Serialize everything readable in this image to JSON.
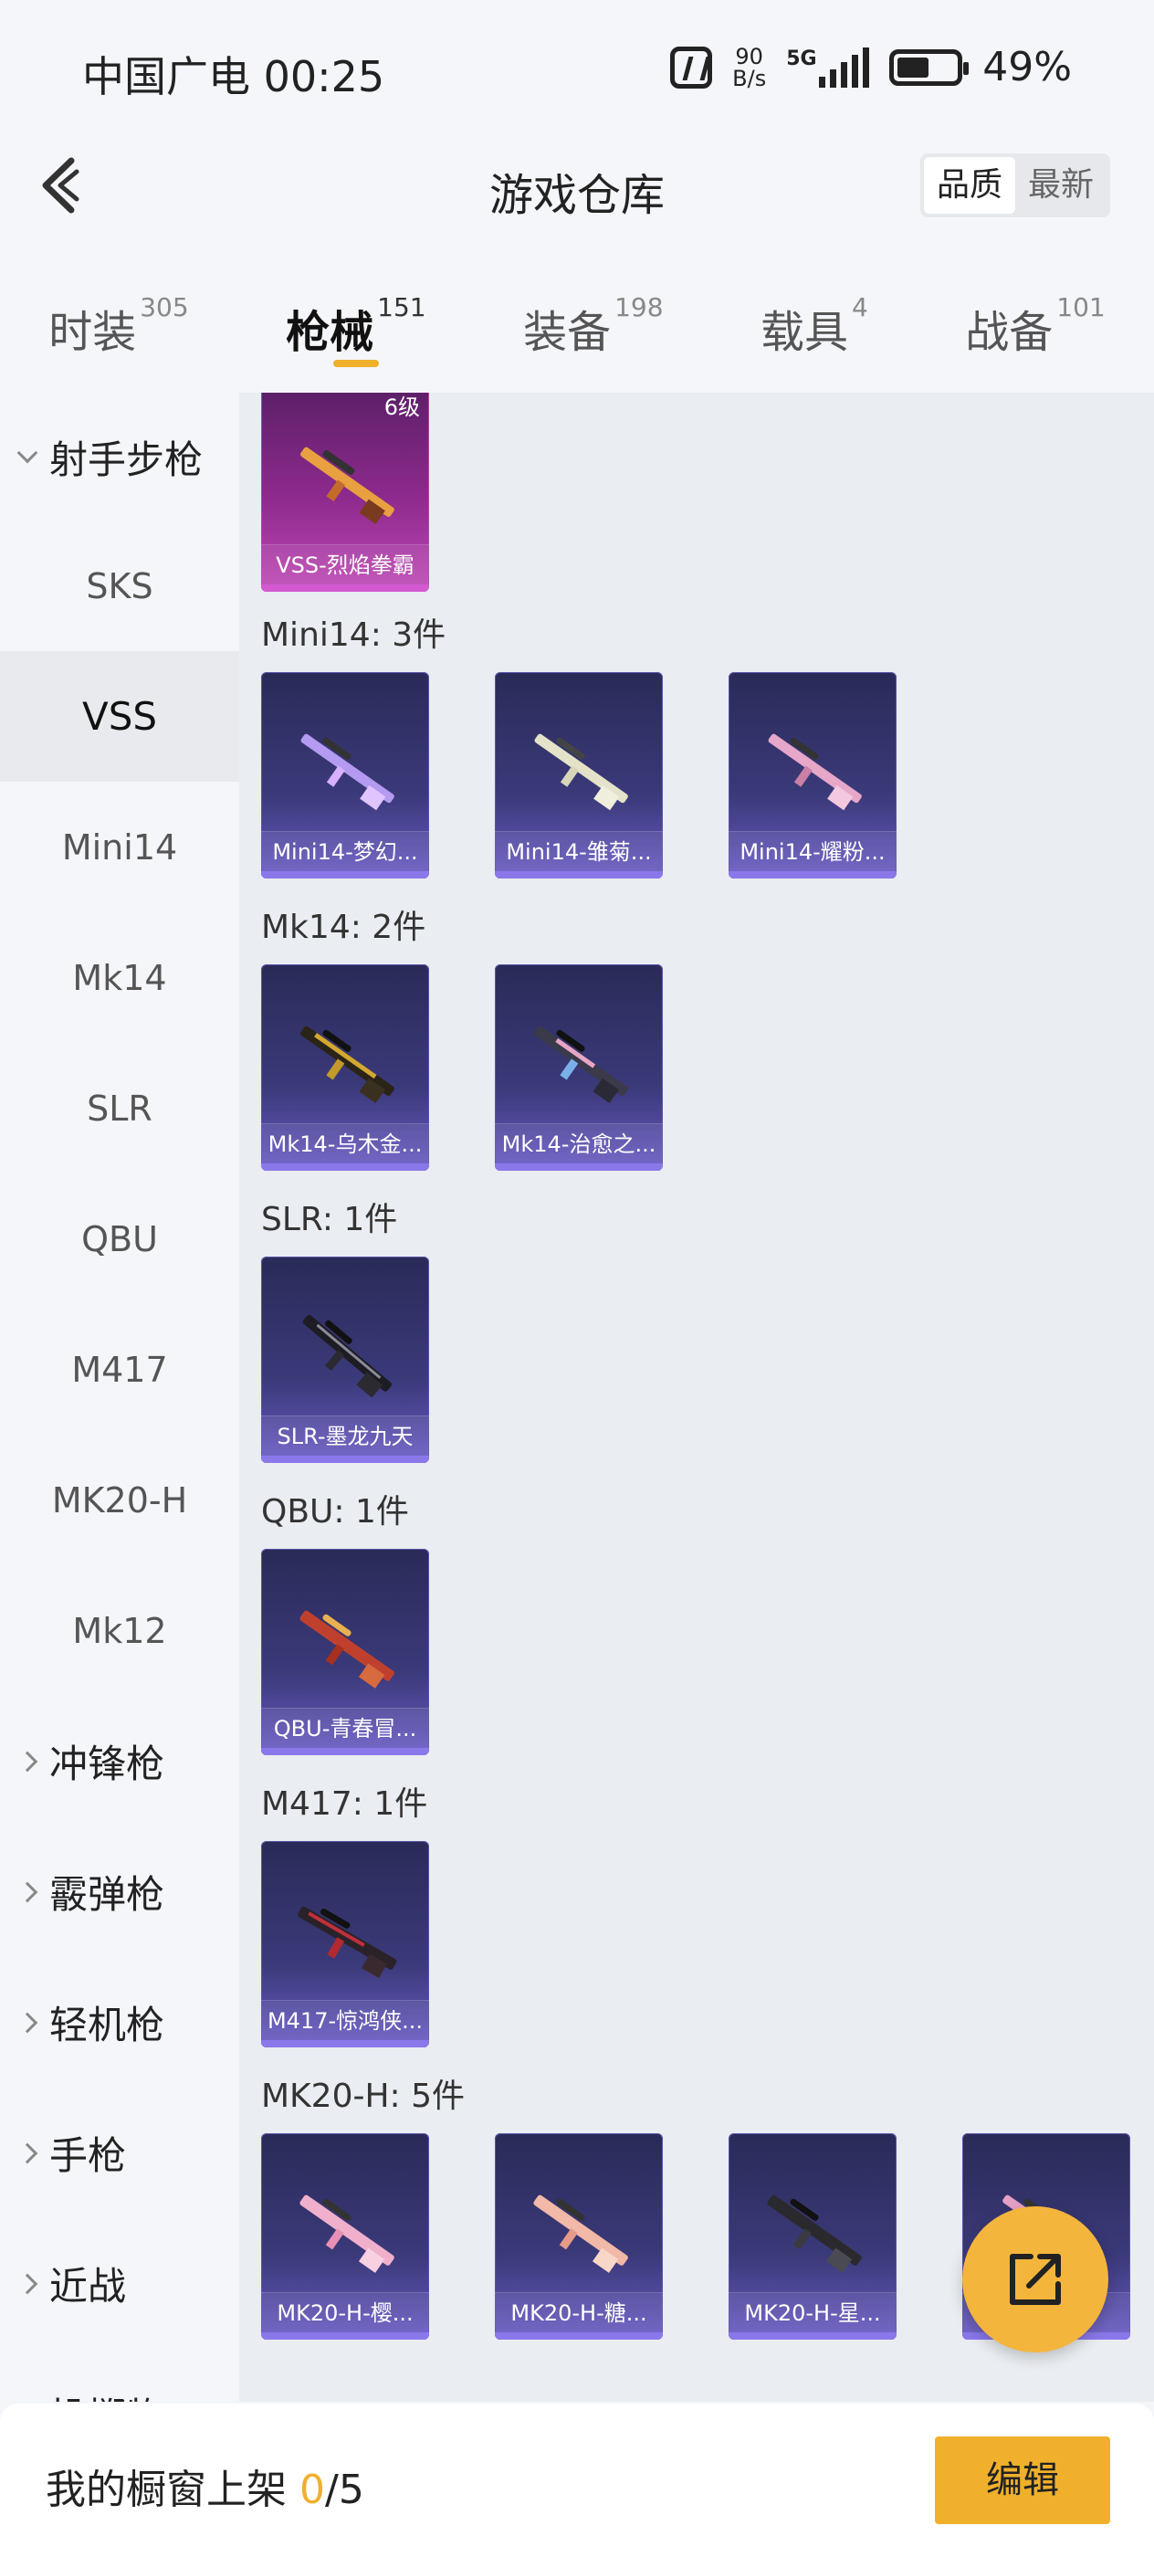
{
  "status_bar": {
    "carrier_time": "中国广电 00:25",
    "net_speed_value": "90",
    "net_speed_unit": "B/s",
    "network": "5G",
    "battery": "49%"
  },
  "header": {
    "title": "游戏仓库",
    "sort_options": [
      "品质",
      "最新"
    ],
    "active_sort": "品质"
  },
  "tabs": [
    {
      "label": "时装",
      "count": "305"
    },
    {
      "label": "枪械",
      "count": "151"
    },
    {
      "label": "装备",
      "count": "198"
    },
    {
      "label": "载具",
      "count": "4"
    },
    {
      "label": "战备",
      "count": "101"
    }
  ],
  "active_tab": "枪械",
  "sidebar": {
    "items": [
      {
        "label": "射手步枪",
        "type": "group-open"
      },
      {
        "label": "SKS",
        "type": "sub"
      },
      {
        "label": "VSS",
        "type": "sub-active"
      },
      {
        "label": "Mini14",
        "type": "sub"
      },
      {
        "label": "Mk14",
        "type": "sub"
      },
      {
        "label": "SLR",
        "type": "sub"
      },
      {
        "label": "QBU",
        "type": "sub"
      },
      {
        "label": "M417",
        "type": "sub"
      },
      {
        "label": "MK20-H",
        "type": "sub"
      },
      {
        "label": "Mk12",
        "type": "sub"
      },
      {
        "label": "冲锋枪",
        "type": "group"
      },
      {
        "label": "霰弹枪",
        "type": "group"
      },
      {
        "label": "轻机枪",
        "type": "group"
      },
      {
        "label": "手枪",
        "type": "group"
      },
      {
        "label": "近战",
        "type": "group"
      },
      {
        "label": "投掷物",
        "type": "group"
      }
    ]
  },
  "content": {
    "top_card": {
      "name": "VSS-烈焰拳霸",
      "level": "6级"
    },
    "sections": [
      {
        "label": "Mini14: 3件",
        "items": [
          "Mini14-梦幻...",
          "Mini14-雏菊...",
          "Mini14-耀粉..."
        ]
      },
      {
        "label": "Mk14: 2件",
        "items": [
          "Mk14-乌木金...",
          "Mk14-治愈之..."
        ]
      },
      {
        "label": "SLR: 1件",
        "items": [
          "SLR-墨龙九天"
        ]
      },
      {
        "label": "QBU: 1件",
        "items": [
          "QBU-青春冒..."
        ]
      },
      {
        "label": "M417: 1件",
        "items": [
          "M417-惊鸿侠..."
        ]
      },
      {
        "label": "MK20-H: 5件",
        "items": [
          "MK20-H-樱...",
          "MK20-H-糖...",
          "MK20-H-星...",
          ""
        ]
      }
    ]
  },
  "bottom_bar": {
    "showcase_prefix": "我的橱窗上架 ",
    "showcase_current": "0",
    "showcase_total": "/5",
    "edit_label": "编辑"
  },
  "colors": {
    "accent": "#f0b02c",
    "card_blue": "#3b3a7a",
    "card_purple": "#8e2a8e"
  }
}
